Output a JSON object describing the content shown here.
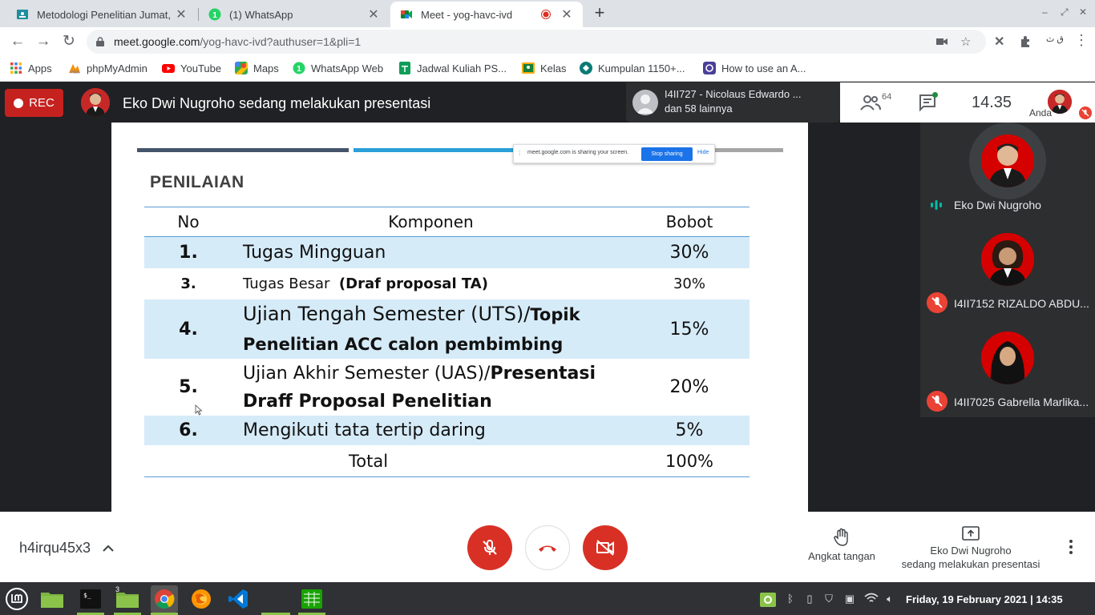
{
  "browser": {
    "tabs": [
      {
        "title": "Metodologi Penelitian Jumat,",
        "active": false
      },
      {
        "title": "(1) WhatsApp",
        "active": false
      },
      {
        "title": "Meet - yog-havc-ivd",
        "active": true
      }
    ],
    "new_tab": "+",
    "url_host": "meet.google.com",
    "url_path": "/yog-havc-ivd?authuser=1&pli=1",
    "extension_text": "ق ث",
    "bookmarks": [
      {
        "label": "Apps",
        "icon": "apps-grid-icon"
      },
      {
        "label": "phpMyAdmin",
        "icon": "phpmyadmin-icon"
      },
      {
        "label": "YouTube",
        "icon": "youtube-icon"
      },
      {
        "label": "Maps",
        "icon": "maps-icon"
      },
      {
        "label": "WhatsApp Web",
        "icon": "whatsapp-icon"
      },
      {
        "label": "Jadwal Kuliah PS...",
        "icon": "sheets-icon"
      },
      {
        "label": "Kelas",
        "icon": "classroom-icon"
      },
      {
        "label": "Kumpulan 1150+...",
        "icon": "site-icon"
      },
      {
        "label": "How to use an A...",
        "icon": "site-icon-2"
      }
    ]
  },
  "meet": {
    "rec_label": "REC",
    "presenting_banner": "Eko Dwi Nugroho sedang melakukan presentasi",
    "notice": {
      "name": "I4II727 - Nicolaus Edwardo ...",
      "more": "dan 58 lainnya"
    },
    "people_count": "64",
    "time": "14.35",
    "self_label": "Anda",
    "share_popup": {
      "message": "meet.google.com is sharing your screen.",
      "stop": "Stop sharing",
      "hide": "Hide"
    },
    "slide": {
      "title": "PENILAIAN",
      "headers": {
        "no": "No",
        "komponen": "Komponen",
        "bobot": "Bobot"
      },
      "rows": [
        {
          "no": "1.",
          "komponen": "Tugas Mingguan",
          "bobot": "30%"
        },
        {
          "no": "3.",
          "komponen_a": "Tugas Besar",
          "komponen_b": "(Draf proposal TA)",
          "bobot": "30%"
        },
        {
          "no": "4.",
          "komponen_a": "Ujian Tengah Semester (UTS)/",
          "komponen_b": "Topik",
          "komponen_c": "Penelitian ACC calon pembimbing",
          "bobot": "15%"
        },
        {
          "no": "5.",
          "komponen_a": "Ujian Akhir Semester (UAS)/",
          "komponen_b": "Presentasi",
          "komponen_c": "Draff Proposal Penelitian",
          "bobot": "20%"
        },
        {
          "no": "6.",
          "komponen": "Mengikuti tata tertip daring",
          "bobot": "5%"
        }
      ],
      "total_label": "Total",
      "total_value": "100%"
    },
    "participants": [
      {
        "name": "Eko Dwi Nugroho",
        "status": "speaking"
      },
      {
        "name": "I4II7152 RIZALDO ABDU...",
        "status": "muted"
      },
      {
        "name": "I4II7025 Gabrella Marlika...",
        "status": "muted"
      }
    ],
    "meeting_code": "h4irqu45x3",
    "raise_hand_label": "Angkat tangan",
    "present_label_1": "Eko Dwi Nugroho",
    "present_label_2": "sedang melakukan presentasi"
  },
  "taskbar": {
    "clock": "Friday, 19  February 2021   |  14:35",
    "folder_badge": "3"
  },
  "colors": {
    "rec": "#c5221f",
    "mic_off": "#d93025",
    "accent": "#1a73e8",
    "slide_row": "#d6ebf8"
  }
}
